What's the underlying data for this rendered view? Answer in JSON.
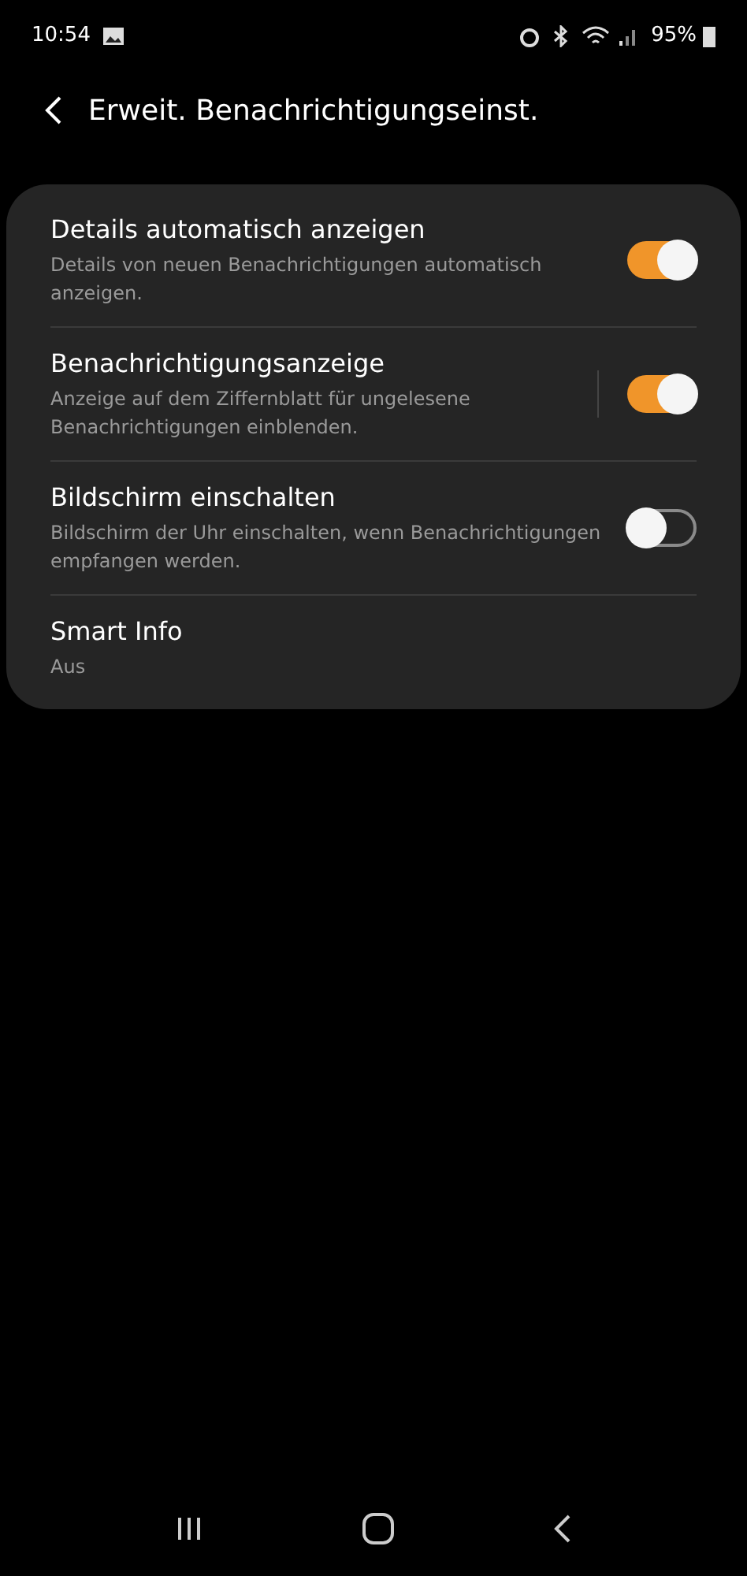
{
  "status_bar": {
    "time": "10:54",
    "battery": "95%"
  },
  "header": {
    "title": "Erweit. Benachrichtigungseinst."
  },
  "items": [
    {
      "kind": "toggle",
      "title": "Details automatisch anzeigen",
      "subtitle": "Details von neuen Benachrichtigungen automatisch anzeigen.",
      "on": true,
      "split": false
    },
    {
      "kind": "toggle",
      "title": "Benachrichtigungsanzeige",
      "subtitle": "Anzeige auf dem Ziffernblatt für ungelesene Benachrichtigungen einblenden.",
      "on": true,
      "split": true
    },
    {
      "kind": "toggle",
      "title": "Bildschirm einschalten",
      "subtitle": "Bildschirm der Uhr einschalten, wenn Benachrichtigungen empfangen werden.",
      "on": false,
      "split": false
    },
    {
      "kind": "link",
      "title": "Smart Info",
      "subtitle": "Aus"
    }
  ]
}
